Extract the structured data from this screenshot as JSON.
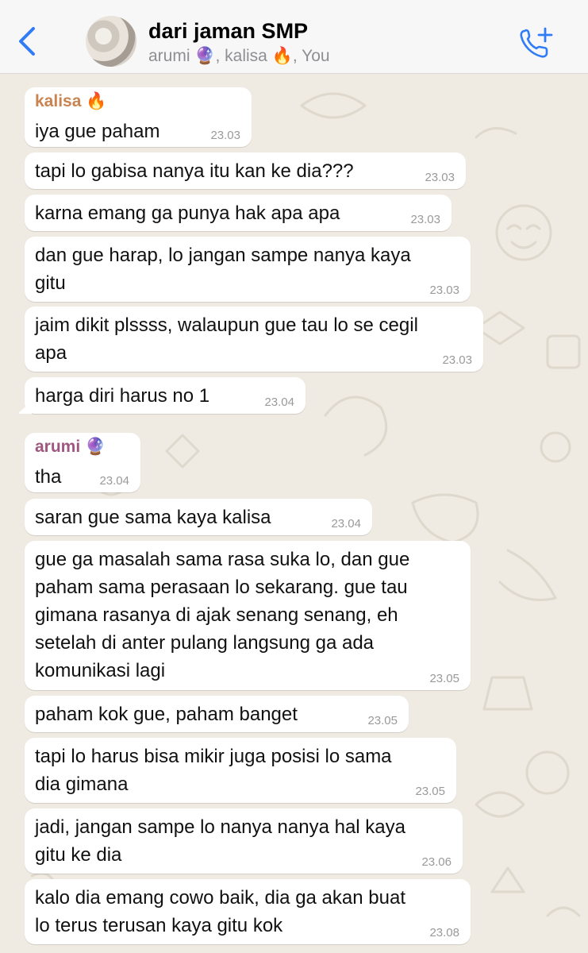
{
  "header": {
    "back_icon": "chevron-left-icon",
    "group_name": "dari jaman SMP",
    "members": "arumi 🔮, kalisa 🔥, You",
    "call_icon": "add-call-icon",
    "accent_color": "#2f7cf6"
  },
  "messages": [
    {
      "sender": "kalisa 🔥",
      "sender_color": "#c9834f",
      "text": "iya gue paham",
      "time": "23.03"
    },
    {
      "text": "tapi lo gabisa nanya itu kan ke dia???",
      "time": "23.03"
    },
    {
      "text": "karna emang ga punya hak apa apa",
      "time": "23.03"
    },
    {
      "text": "dan gue harap, lo jangan sampe nanya kaya\ngitu",
      "time": "23.03"
    },
    {
      "text": "jaim dikit plssss, walaupun gue tau lo se cegil\napa",
      "time": "23.03"
    },
    {
      "text": "harga diri harus no 1",
      "time": "23.04"
    },
    {
      "sender": "arumi 🔮",
      "sender_color": "#a0577f",
      "text": "tha",
      "time": "23.04"
    },
    {
      "text": "saran gue sama kaya kalisa",
      "time": "23.04"
    },
    {
      "text": "gue ga masalah sama rasa suka lo, dan gue\npaham sama perasaan lo sekarang. gue tau\ngimana rasanya di ajak senang senang, eh\nsetelah di anter pulang langsung ga ada\nkomunikasi lagi",
      "time": "23.05"
    },
    {
      "text": "paham kok gue, paham banget",
      "time": "23.05"
    },
    {
      "text": "tapi lo harus bisa mikir juga posisi lo sama\ndia gimana",
      "time": "23.05"
    },
    {
      "text": "jadi, jangan sampe lo nanya nanya hal kaya\ngitu ke dia",
      "time": "23.06"
    },
    {
      "text": "kalo dia emang cowo baik, dia ga akan buat\nlo terus terusan kaya gitu kok",
      "time": "23.08"
    }
  ]
}
